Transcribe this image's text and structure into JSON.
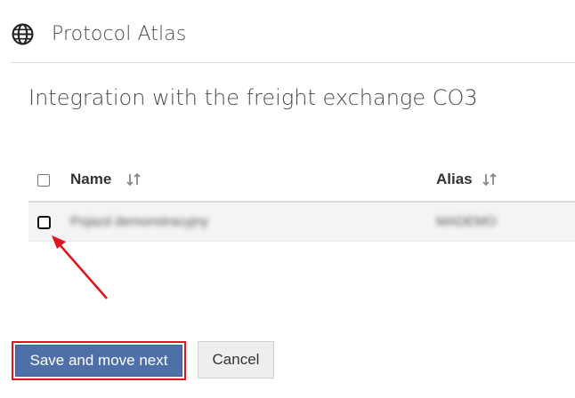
{
  "header": {
    "app_title": "Protocol Atlas",
    "icon": "globe-icon"
  },
  "page": {
    "title": "Integration with the freight exchange CO3"
  },
  "table": {
    "columns": [
      {
        "label": "Name",
        "sortable": true
      },
      {
        "label": "Alias",
        "sortable": true
      }
    ],
    "rows": [
      {
        "name": "Pojazd demonstracyjny",
        "alias": "MADEMO",
        "checked": false,
        "blurred": true
      }
    ]
  },
  "annotation": {
    "arrow_color": "#e0141e",
    "highlight_color": "#e0141e"
  },
  "buttons": {
    "save_label": "Save and move next",
    "cancel_label": "Cancel"
  },
  "colors": {
    "primary_button": "#4f6fa8",
    "secondary_button": "#eeeeee"
  }
}
